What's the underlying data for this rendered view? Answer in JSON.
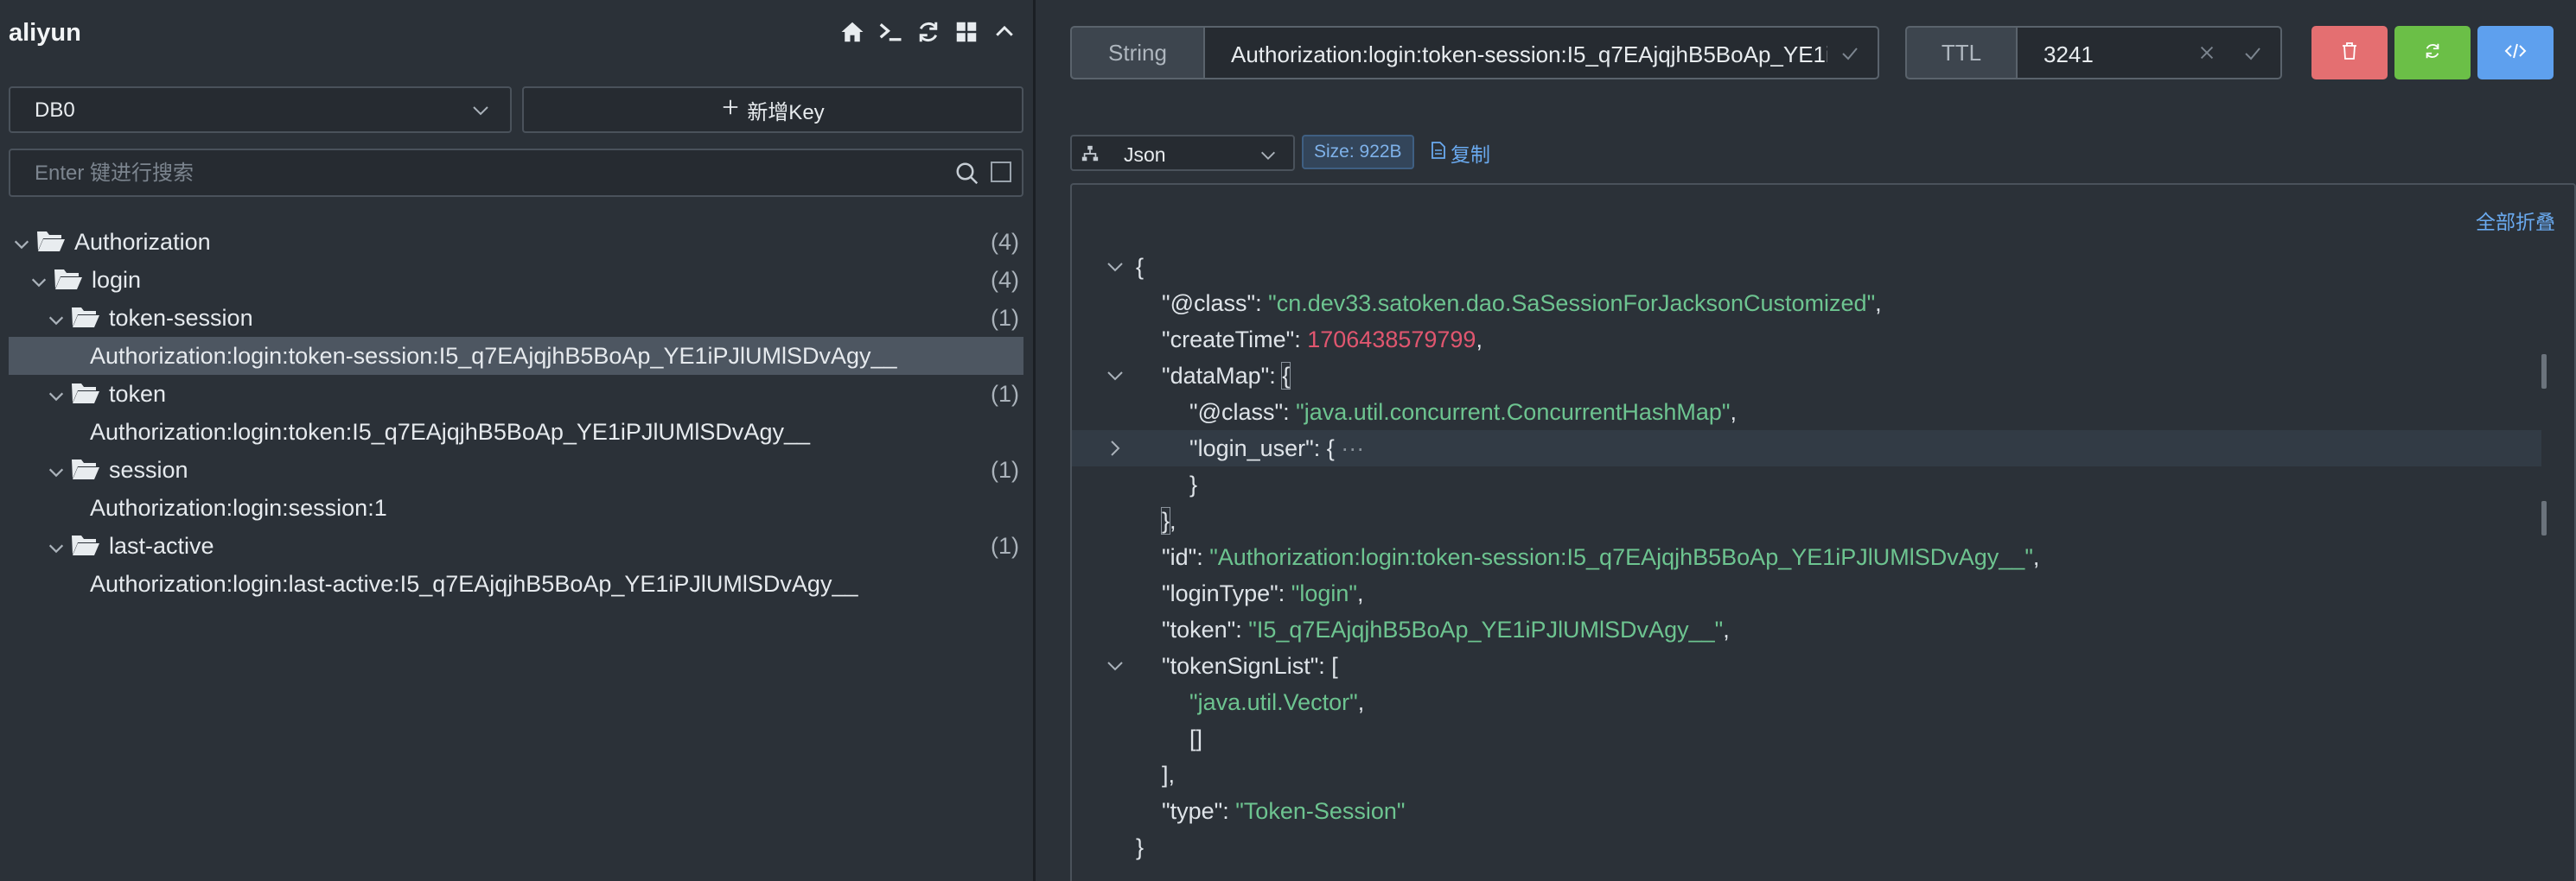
{
  "connection": {
    "name": "aliyun"
  },
  "toolbar_icons": [
    "home-icon",
    "terminal-icon",
    "refresh-icon",
    "grid-icon",
    "chevron-up-icon"
  ],
  "db_select": {
    "value": "DB0"
  },
  "add_key": {
    "label": "新增Key"
  },
  "search": {
    "placeholder": "Enter 键进行搜索",
    "value": ""
  },
  "tree": {
    "nodes": [
      {
        "label": "Authorization",
        "count": "(4)"
      },
      {
        "label": "login",
        "count": "(4)"
      },
      {
        "label": "token-session",
        "count": "(1)"
      },
      {
        "label": "Authorization:login:token-session:I5_q7EAjqjhB5BoAp_YE1iPJlUMlSDvAgy__"
      },
      {
        "label": "token",
        "count": "(1)"
      },
      {
        "label": "Authorization:login:token:I5_q7EAjqjhB5BoAp_YE1iPJlUMlSDvAgy__"
      },
      {
        "label": "session",
        "count": "(1)"
      },
      {
        "label": "Authorization:login:session:1"
      },
      {
        "label": "last-active",
        "count": "(1)"
      },
      {
        "label": "Authorization:login:last-active:I5_q7EAjqjhB5BoAp_YE1iPJlUMlSDvAgy__"
      }
    ]
  },
  "key_detail": {
    "type": "String",
    "key_name": "Authorization:login:token-session:I5_q7EAjqjhB5BoAp_YE1iPJlUMlSDvAgy__",
    "ttl_label": "TTL",
    "ttl_value": "3241",
    "format": "Json",
    "size": "Size: 922B",
    "copy_label": "复制",
    "collapse_all": "全部折叠"
  },
  "colors": {
    "delete": "#e46f71",
    "refresh": "#6bbf47",
    "code": "#5ea0ee",
    "string": "#6dc490",
    "number": "#e0566f",
    "link": "#6aaaf0"
  },
  "json_view": {
    "l1": "{",
    "k_class": "\"@class\"",
    "v_class": "\"cn.dev33.satoken.dao.SaSessionForJacksonCustomized\"",
    "k_create": "\"createTime\"",
    "v_create": "1706438579799",
    "k_datamap": "\"dataMap\"",
    "k_class2": "\"@class\"",
    "v_class2": "\"java.util.concurrent.ConcurrentHashMap\"",
    "k_login_user": "\"login_user\"",
    "collapsed": "···",
    "k_id": "\"id\"",
    "v_id": "\"Authorization:login:token-session:I5_q7EAjqjhB5BoAp_YE1iPJlUMlSDvAgy__\"",
    "k_logintype": "\"loginType\"",
    "v_logintype": "\"login\"",
    "k_token": "\"token\"",
    "v_token": "\"I5_q7EAjqjhB5BoAp_YE1iPJlUMlSDvAgy__\"",
    "k_signlist": "\"tokenSignList\"",
    "v_vector": "\"java.util.Vector\"",
    "v_empty": "[]",
    "k_type": "\"type\"",
    "v_type": "\"Token-Session\""
  }
}
